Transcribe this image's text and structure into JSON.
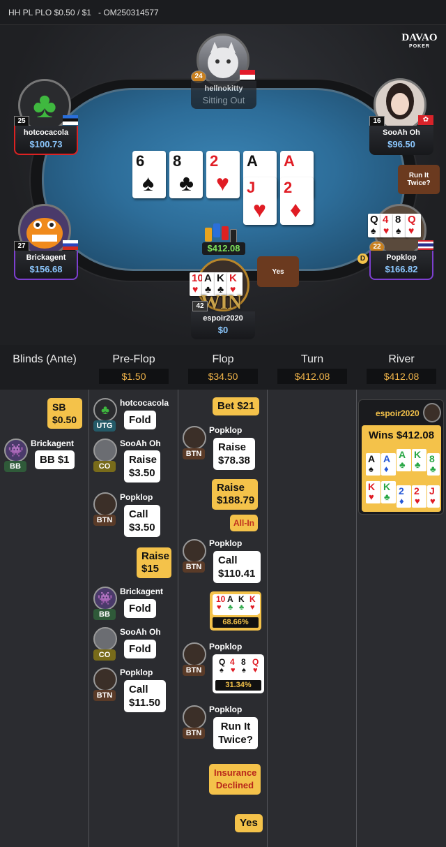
{
  "topbar": {
    "title": "HH PL PLO $0.50 / $1",
    "hand_id": "- OM250314577"
  },
  "logo": {
    "brand": "DAVAO",
    "sub": "POKER"
  },
  "players": {
    "hellnokitty": {
      "name": "hellnokitty",
      "level": "24",
      "status": "Sitting Out"
    },
    "hotcocacola": {
      "name": "hotcocacola",
      "level": "25",
      "stack": "$100.73"
    },
    "sooah": {
      "name": "SooAh Oh",
      "level": "16",
      "stack": "$96.50"
    },
    "brickagent": {
      "name": "Brickagent",
      "level": "27",
      "stack": "$156.68"
    },
    "popklop": {
      "name": "Popklop",
      "level": "22",
      "stack": "$166.82",
      "dealer": "D"
    },
    "espoir": {
      "name": "espoir2020",
      "level": "42",
      "stack": "$0",
      "win_label": "WIN"
    }
  },
  "bubbles": {
    "run_it_twice": "Run It Twice?",
    "yes": "Yes"
  },
  "board": {
    "row1": [
      {
        "r": "6",
        "s": "♠"
      },
      {
        "r": "8",
        "s": "♣"
      },
      {
        "r": "2",
        "s": "♥"
      },
      {
        "r": "A",
        "s": "♠"
      },
      {
        "r": "A",
        "s": "♥"
      }
    ],
    "row2": [
      {
        "r": "J",
        "s": "♥"
      },
      {
        "r": "2",
        "s": "♦"
      }
    ]
  },
  "pot": "$412.08",
  "columns": [
    {
      "title": "Blinds (Ante)",
      "value": ""
    },
    {
      "title": "Pre-Flop",
      "value": "$1.50"
    },
    {
      "title": "Flop",
      "value": "$34.50"
    },
    {
      "title": "Turn",
      "value": "$412.08"
    },
    {
      "title": "River",
      "value": "$412.08"
    }
  ],
  "blinds": {
    "sb_label": "SB",
    "sb_amt": "$0.50",
    "bb_player": "Brickagent",
    "bb_pos": "BB",
    "bb_action": "BB  $1"
  },
  "preflop": [
    {
      "player": "hotcocacola",
      "pos": "UTG",
      "action": "Fold"
    },
    {
      "player": "SooAh Oh",
      "pos": "CO",
      "action": "Raise $3.50"
    },
    {
      "player": "Popklop",
      "pos": "BTN",
      "action": "Call $3.50"
    },
    {
      "hero_action": "Raise $15"
    },
    {
      "player": "Brickagent",
      "pos": "BB",
      "action": "Fold"
    },
    {
      "player": "SooAh Oh",
      "pos": "CO",
      "action": "Fold"
    },
    {
      "player": "Popklop",
      "pos": "BTN",
      "action": "Call $11.50"
    }
  ],
  "flop": {
    "bet": "Bet  $21",
    "raise1_player": "Popklop",
    "raise1_pos": "BTN",
    "raise1": "Raise $78.38",
    "raise2": "Raise $188.79",
    "allin": "All-In",
    "call_player": "Popklop",
    "call_pos": "BTN",
    "call": "Call $110.41",
    "hero_equity": "68.66%",
    "villain_player": "Popklop",
    "villain_pos": "BTN",
    "villain_equity": "31.34%",
    "rit_player": "Popklop",
    "rit_pos": "BTN",
    "rit": "Run It Twice?",
    "insurance": "Insurance Declined",
    "yes": "Yes"
  },
  "river": {
    "winner": "espoir2020",
    "wins": "Wins $412.08"
  },
  "colors": {
    "accent": "#f4c24a",
    "stack": "#8cc8ff",
    "pot": "#7de35a"
  }
}
